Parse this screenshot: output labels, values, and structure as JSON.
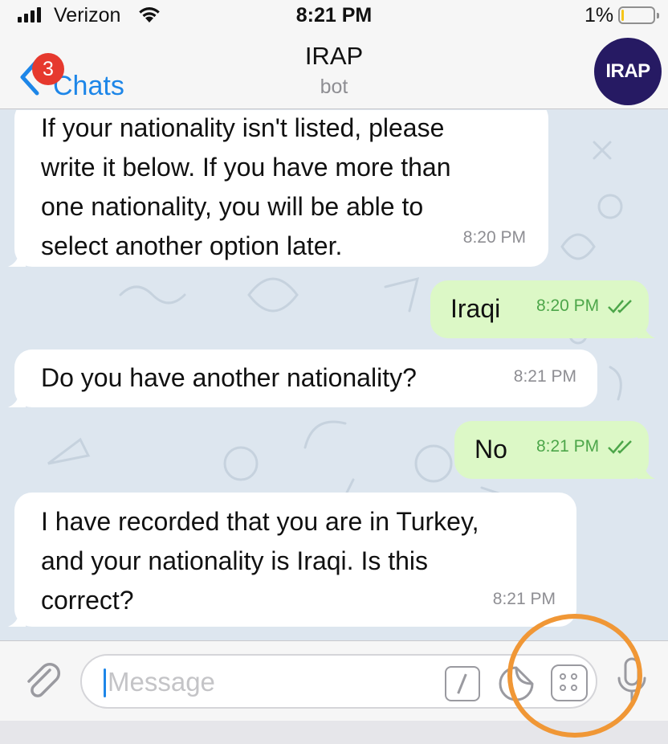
{
  "status_bar": {
    "carrier": "Verizon",
    "time": "8:21 PM",
    "battery_percent": "1%"
  },
  "header": {
    "back_label": "Chats",
    "unread_badge": "3",
    "title": "IRAP",
    "subtitle": "bot",
    "avatar_text": "IRAP"
  },
  "messages": [
    {
      "direction": "in",
      "text": "If your nationality isn't listed, please\nwrite it below. If you have more than\none nationality, you will be able to\nselect another option later.",
      "time": "8:20 PM"
    },
    {
      "direction": "out",
      "text": "Iraqi",
      "time": "8:20 PM",
      "status": "read"
    },
    {
      "direction": "in",
      "text": "Do you have another nationality?",
      "time": "8:21 PM"
    },
    {
      "direction": "out",
      "text": "No",
      "time": "8:21 PM",
      "status": "read"
    },
    {
      "direction": "in",
      "text": "I have recorded that you are in Turkey,\nand your nationality is Iraqi. Is this\ncorrect?",
      "time": "8:21 PM"
    }
  ],
  "input": {
    "placeholder": "Message"
  },
  "colors": {
    "accent": "#1d86e8",
    "outgoing_bubble": "#dcf8c6",
    "read_check": "#4da64a",
    "badge": "#e6392e",
    "avatar_bg": "#261a63",
    "highlight_ring": "#f09736"
  },
  "icons": {
    "back": "chevron-left-icon",
    "attach": "paperclip-icon",
    "commands": "slash-command-icon",
    "sticker": "sticker-icon",
    "bot_menu": "bot-keyboard-icon",
    "voice": "microphone-icon"
  }
}
